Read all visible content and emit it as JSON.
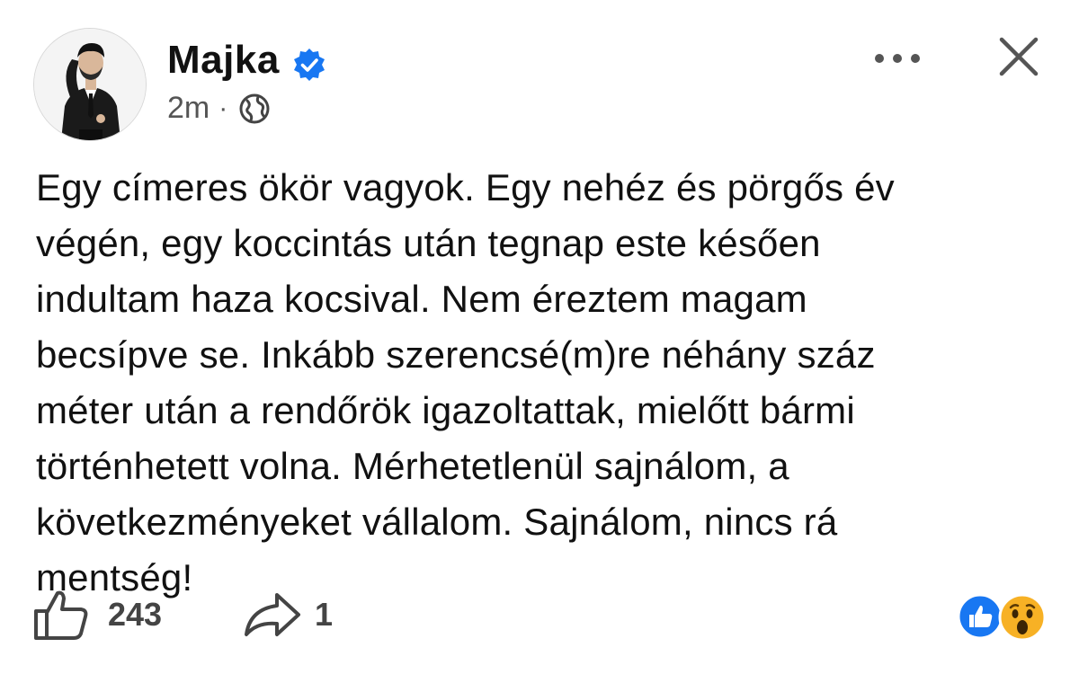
{
  "post": {
    "author": {
      "name": "Majka",
      "verified_icon": "verified-badge-icon",
      "avatar_icon": "avatar-man-in-suit"
    },
    "meta": {
      "time": "2m",
      "separator": "·",
      "audience_icon": "globe-icon"
    },
    "text_lines": [
      "Egy címeres ökör vagyok. Egy nehéz és pörgős év",
      "végén, egy koccintás után tegnap este késően",
      "indultam haza kocsival. Nem éreztem magam",
      "becsípve se. Inkább szerencsé(m)re néhány száz",
      "méter után a rendőrök igazoltattak, mielőtt bármi",
      "történhetett volna. Mérhetetlenül sajnálom, a",
      "következményeket vállalom. Sajnálom, nincs rá",
      "mentség!"
    ],
    "stats": {
      "likes": "243",
      "shares": "1"
    },
    "reactions": [
      "like-reaction-icon",
      "wow-reaction-icon"
    ]
  },
  "colors": {
    "verified_blue": "#1877F2",
    "like_blue": "#1877F2",
    "wow_yellow": "#F7B125",
    "text": "#111111",
    "muted": "#555555"
  }
}
